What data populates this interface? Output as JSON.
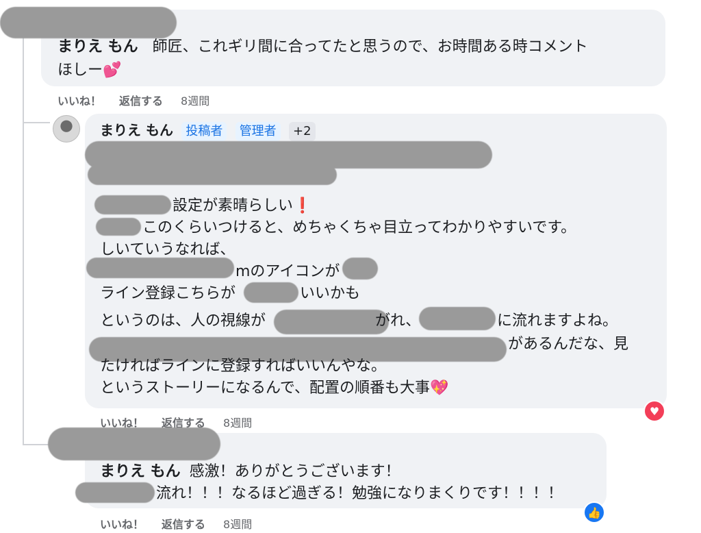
{
  "comment1": {
    "author": "まりえ もん",
    "text_line1": "師匠、これギリ間に合ってたと思うので、お時間ある時コメント",
    "text_line2": "ほしー",
    "emoji": "💕",
    "actions": {
      "like": "いいね！",
      "reply": "返信する",
      "time": "8週間"
    }
  },
  "reply1": {
    "author": "まりえ もん",
    "badges": [
      "投稿者",
      "管理者",
      "+2"
    ],
    "lines": [
      {
        "text": "設定が素晴らしい",
        "suffix": "❗"
      },
      {
        "text": "このくらいつけると、めちゃくちゃ目立ってわかりやすいです。"
      },
      {
        "text": "しいていうなれば、"
      },
      {
        "text": "mのアイコンが"
      },
      {
        "text": "ライン登録こちらが"
      },
      {
        "text": "いいかも"
      },
      {
        "text": "というのは、人の視線が"
      },
      {
        "text": "がれ、"
      },
      {
        "text": "に流れますよね。"
      },
      {
        "text": "があるんだな、見"
      },
      {
        "text": "たければラインに登録すればいいんやな。"
      },
      {
        "text": "というストーリーになるんで、配置の順番も大事",
        "suffix": "💖"
      }
    ],
    "actions": {
      "like": "いいね！",
      "reply": "返信する",
      "time": "8週間"
    },
    "reaction": "love"
  },
  "reply2": {
    "author": "まりえ もん",
    "text_line1": "感激！ありがとうございます！",
    "text_line2": "流れ！！！なるほど過ぎる！勉強になりまくりです！！！！",
    "actions": {
      "like": "いいね！",
      "reply": "返信する",
      "time": "8週間"
    },
    "reaction": "like"
  }
}
